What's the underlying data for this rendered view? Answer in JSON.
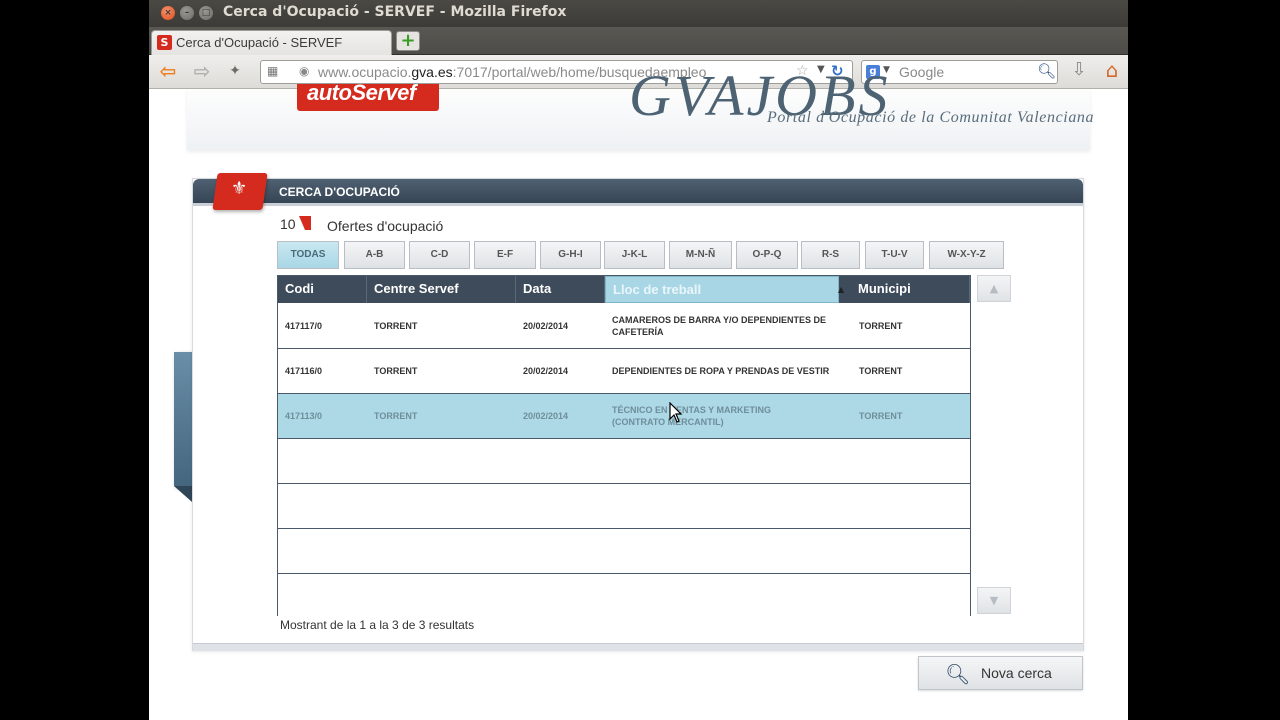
{
  "window": {
    "title": "Cerca d'Ocupació - SERVEF - Mozilla Firefox"
  },
  "tabs": [
    {
      "label": "Cerca d'Ocupació - SERVEF",
      "favicon": "S"
    }
  ],
  "navbar": {
    "url_prefix": "www.ocupacio.",
    "url_domain": "gva.es",
    "url_suffix": ":7017/portal/web/home/busquedaempleo",
    "search_engine": "Google",
    "search_placeholder": "Google"
  },
  "page": {
    "logo_text": "autoServef",
    "brand": "GVAJOBS",
    "brand_subtitle": "Portal d'Ocupació de la Comunitat Valenciana",
    "panel_title": "CERCA D'OCUPACIÓ",
    "offer_count": "10",
    "offers_label": "Ofertes d'ocupació",
    "filters": [
      "TODAS",
      "A-B",
      "C-D",
      "E-F",
      "G-H-I",
      "J-K-L",
      "M-N-Ñ",
      "O-P-Q",
      "R-S",
      "T-U-V",
      "W-X-Y-Z"
    ],
    "active_filter": "TODAS",
    "columns": [
      "Codi",
      "Centre Servef",
      "Data",
      "Lloc de treball",
      "Municipi"
    ],
    "sorted_column": "Lloc de treball",
    "rows": [
      {
        "codi": "417117/0",
        "centre": "TORRENT",
        "data": "20/02/2014",
        "lloc": "CAMAREROS DE BARRA Y/O DEPENDIENTES DE CAFETERÍA",
        "municipi": "TORRENT"
      },
      {
        "codi": "417116/0",
        "centre": "TORRENT",
        "data": "20/02/2014",
        "lloc": "DEPENDIENTES DE ROPA Y PRENDAS DE VESTIR",
        "municipi": "TORRENT"
      },
      {
        "codi": "417113/0",
        "centre": "TORRENT",
        "data": "20/02/2014",
        "lloc": "TÉCNICO EN VENTAS Y MARKETING (CONTRATO MERCANTIL)",
        "municipi": "TORRENT"
      }
    ],
    "selected_row": 3,
    "results_text": "Mostrant de la 1 a la 3 de 3 resultats",
    "new_search_label": "Nova cerca"
  },
  "colors": {
    "accent_red": "#d52b1e",
    "header_dark": "#3d4b5a",
    "selection_blue": "#add8e6"
  },
  "icons": [
    "back-arrow-icon",
    "forward-arrow-icon",
    "home-icon",
    "download-icon",
    "reload-icon",
    "search-icon",
    "bookmark-star-icon",
    "scroll-up-icon",
    "scroll-down-icon",
    "magnifier-icon",
    "chevron-left-icon"
  ]
}
